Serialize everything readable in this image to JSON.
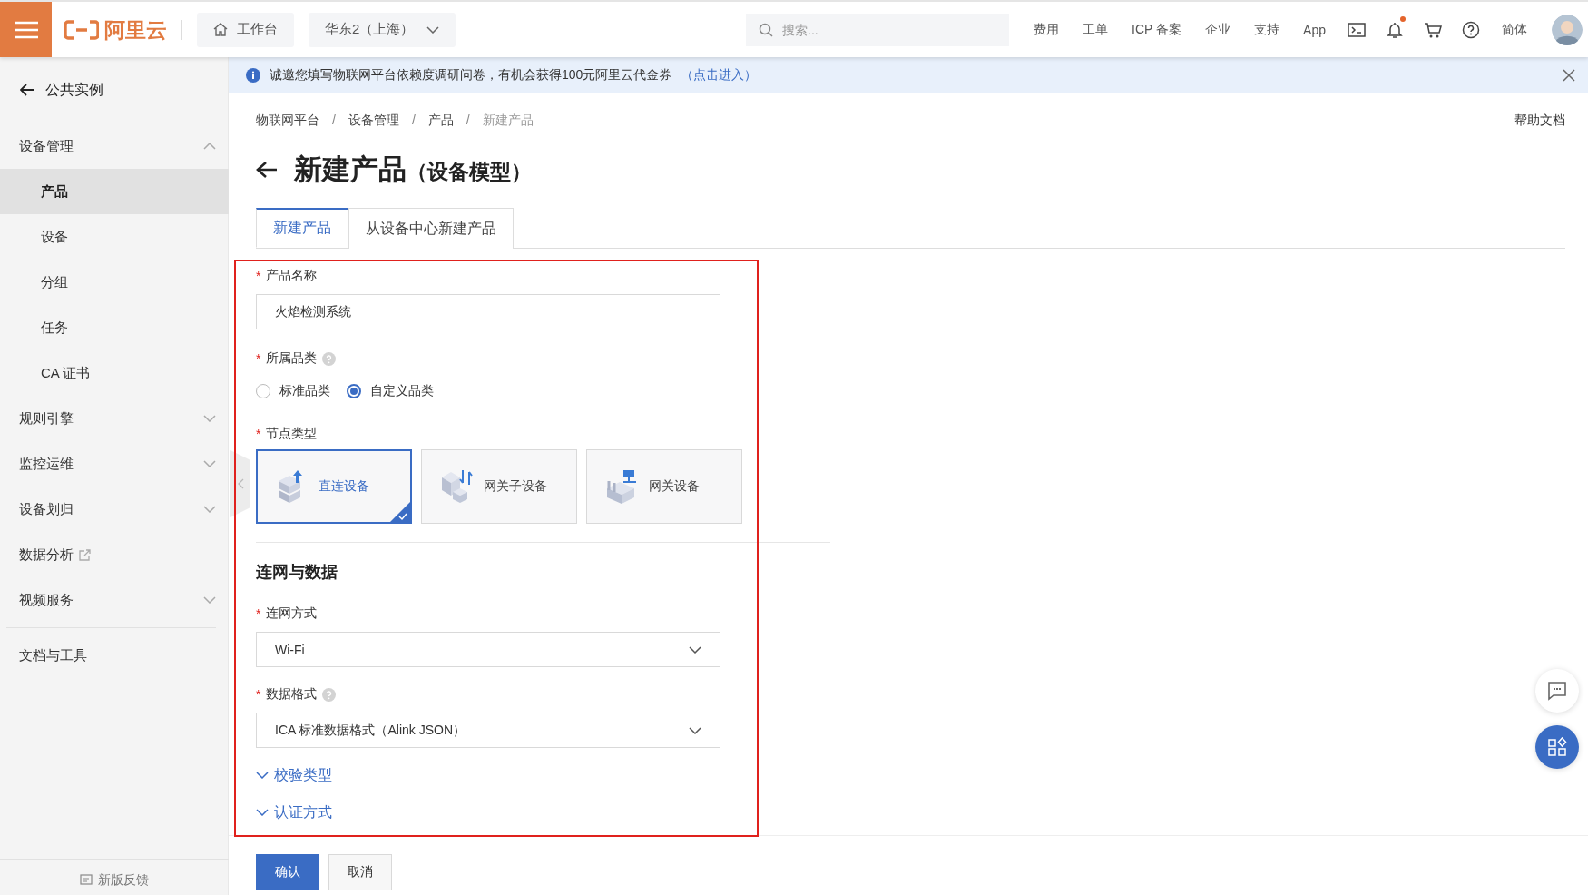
{
  "topbar": {
    "logo": "阿里云",
    "workbench": "工作台",
    "region": "华东2（上海）",
    "search_placeholder": "搜索...",
    "links": [
      "费用",
      "工单",
      "ICP 备案",
      "企业",
      "支持",
      "App"
    ],
    "notification": true,
    "language": "简体"
  },
  "banner": {
    "text": "诚邀您填写物联网平台依赖度调研问卷，有机会获得100元阿里云代金券",
    "link": "（点击进入）"
  },
  "sidebar": {
    "back": "公共实例",
    "items": [
      {
        "kind": "group",
        "label": "设备管理",
        "expanded": true,
        "children": [
          {
            "label": "产品",
            "selected": true
          },
          {
            "label": "设备",
            "selected": false
          },
          {
            "label": "分组",
            "selected": false
          },
          {
            "label": "任务",
            "selected": false
          },
          {
            "label": "CA 证书",
            "selected": false
          }
        ]
      },
      {
        "kind": "group",
        "label": "规则引擎",
        "expanded": false
      },
      {
        "kind": "group",
        "label": "监控运维",
        "expanded": false
      },
      {
        "kind": "group",
        "label": "设备划归",
        "expanded": false
      },
      {
        "kind": "external",
        "label": "数据分析"
      },
      {
        "kind": "group",
        "label": "视频服务",
        "expanded": false
      }
    ],
    "docs": "文档与工具",
    "feedback": "新版反馈"
  },
  "main": {
    "breadcrumb": {
      "separator": "/",
      "items": [
        "物联网平台",
        "设备管理",
        "产品",
        "新建产品"
      ]
    },
    "help": "帮助文档",
    "title": "新建产品",
    "subtitle": "（设备模型）",
    "tabs": [
      {
        "label": "新建产品",
        "selected": true
      },
      {
        "label": "从设备中心新建产品",
        "selected": false
      }
    ],
    "form": {
      "required_mark": "*",
      "product_name": {
        "label": "产品名称",
        "value": "火焰检测系统"
      },
      "category": {
        "label": "所属品类",
        "options": [
          {
            "label": "标准品类",
            "selected": false
          },
          {
            "label": "自定义品类",
            "selected": true
          }
        ]
      },
      "node_type": {
        "label": "节点类型",
        "options": [
          {
            "kind": "direct",
            "label": "直连设备",
            "selected": true
          },
          {
            "kind": "subdevice",
            "label": "网关子设备",
            "selected": false
          },
          {
            "kind": "gateway",
            "label": "网关设备",
            "selected": false
          }
        ]
      },
      "section": "连网与数据",
      "network": {
        "label": "连网方式",
        "value": "Wi-Fi"
      },
      "data_format": {
        "label": "数据格式",
        "value": "ICA 标准数据格式（Alink JSON）"
      },
      "collapsibles": [
        "校验类型",
        "认证方式"
      ]
    },
    "buttons": {
      "confirm": "确认",
      "cancel": "取消"
    }
  }
}
